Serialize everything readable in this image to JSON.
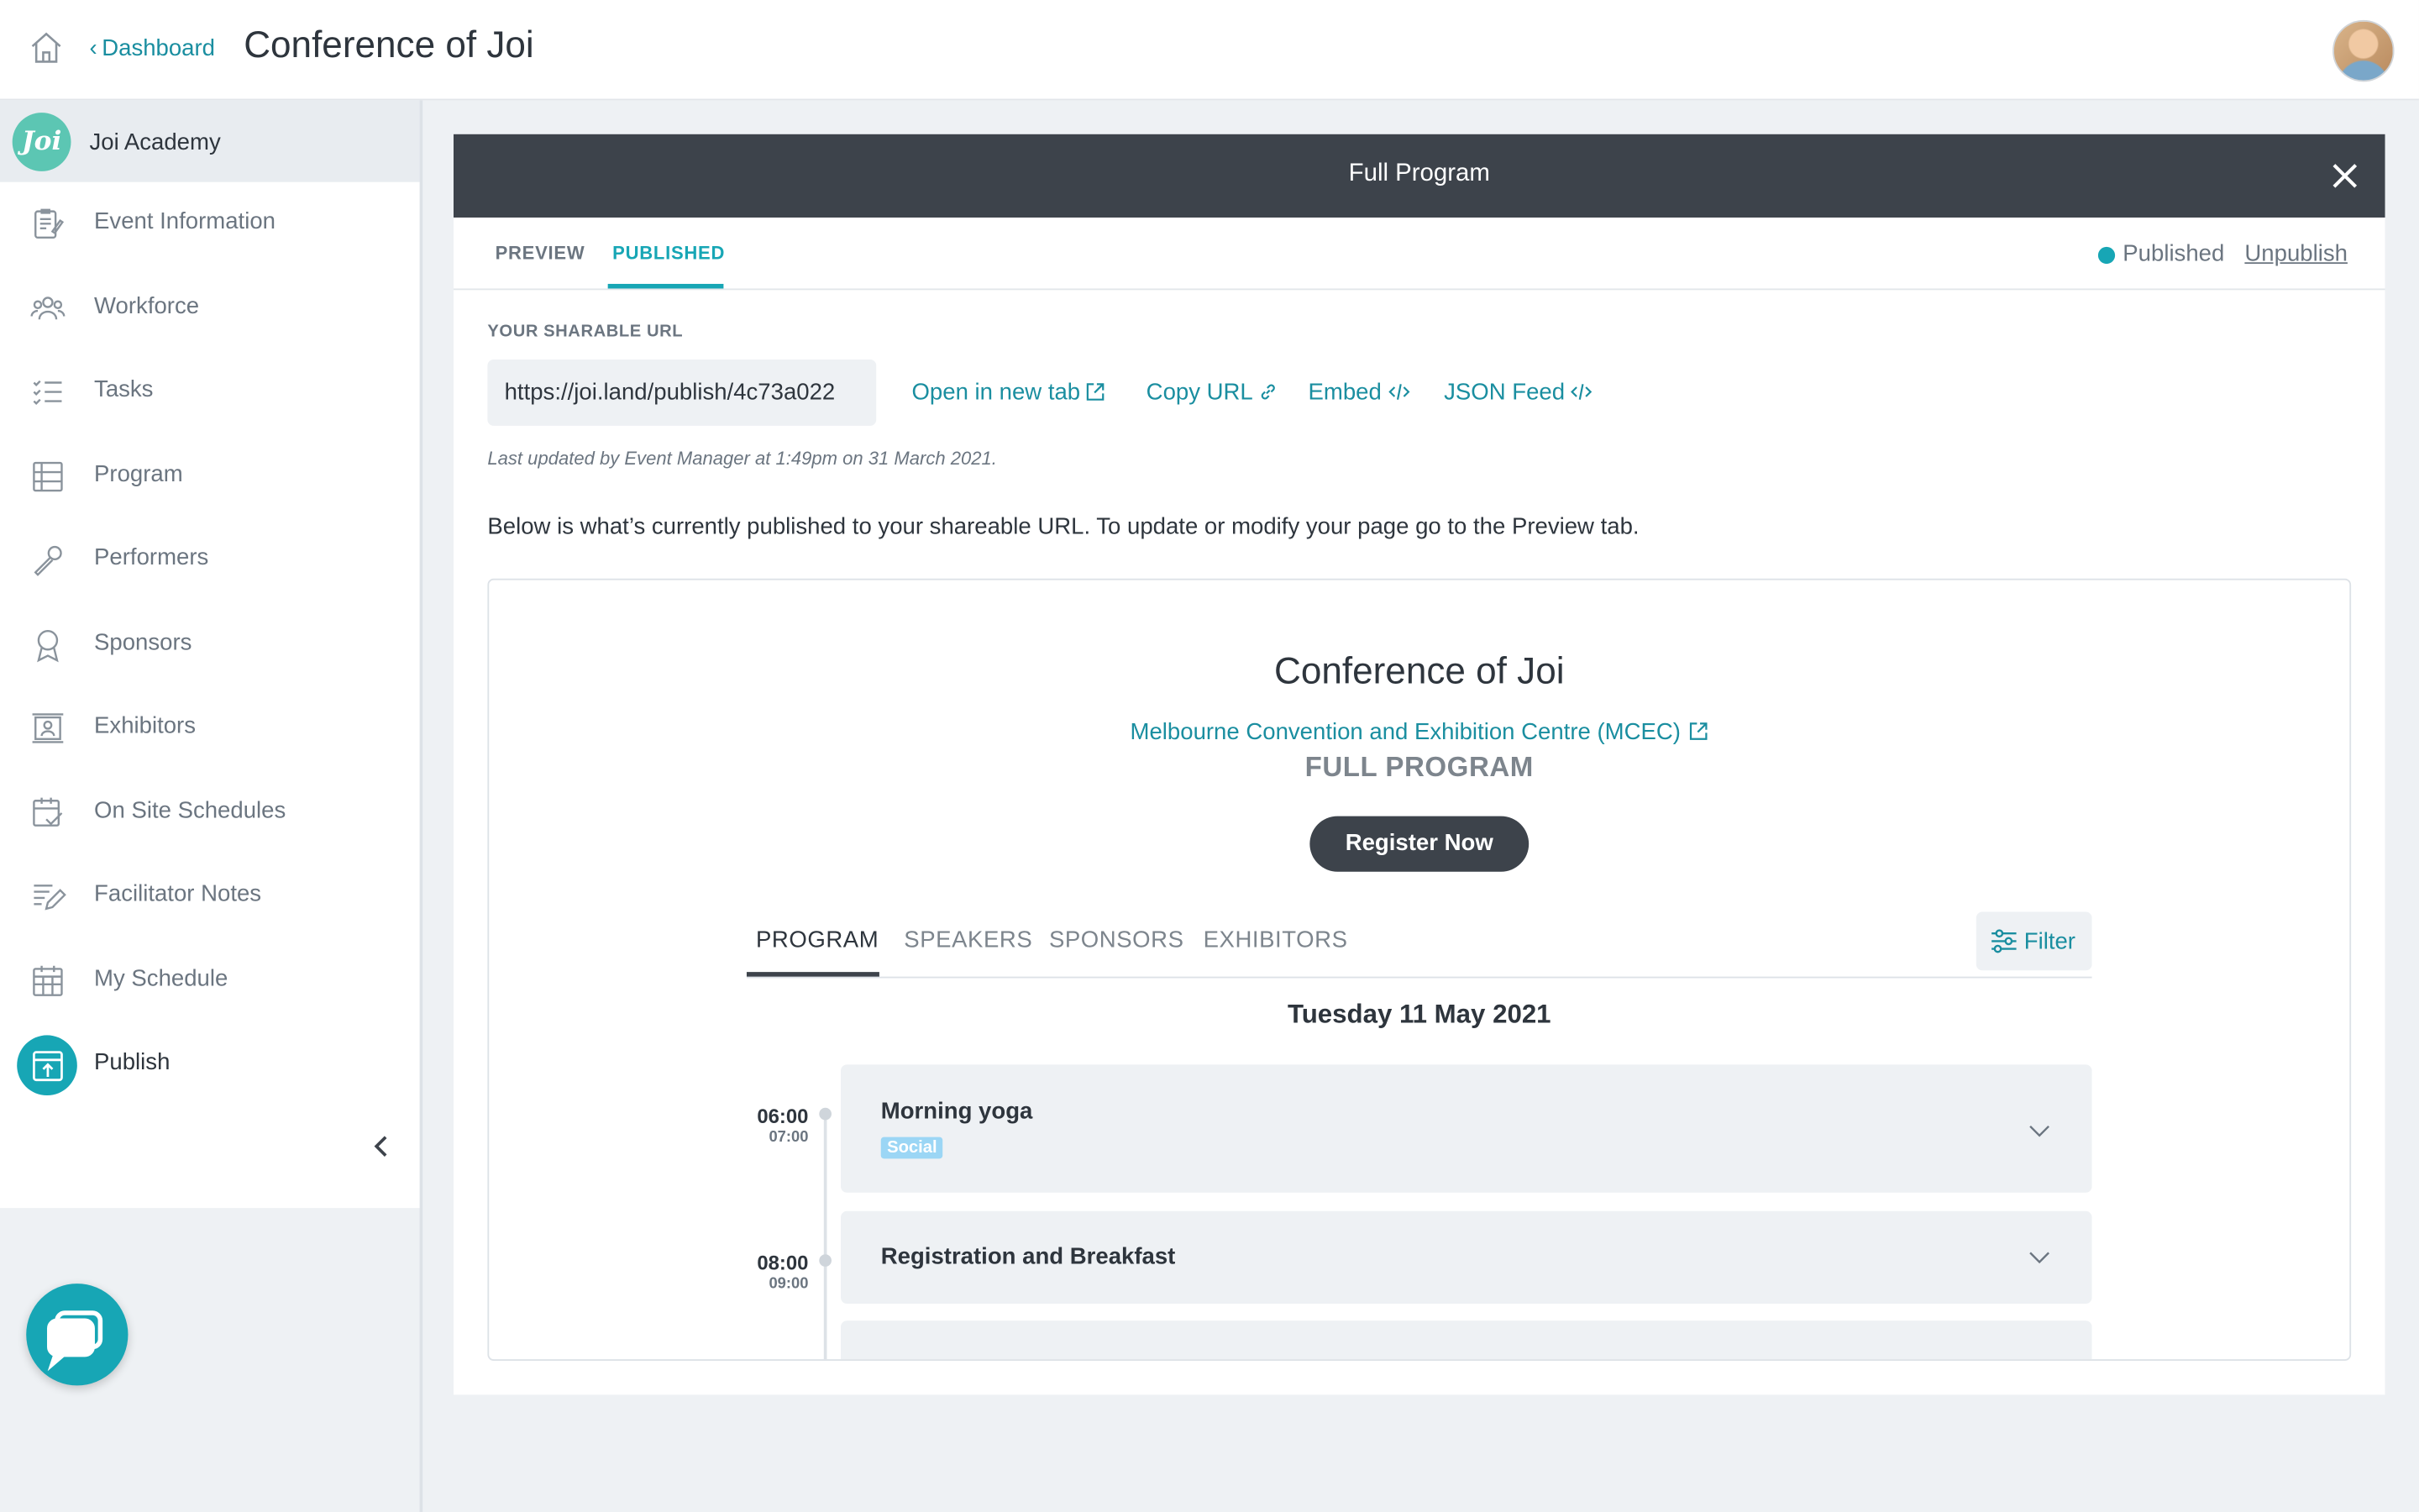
{
  "header": {
    "breadcrumb": "Dashboard",
    "title": "Conference of Joi"
  },
  "sidebar": {
    "org_logo": "Joi",
    "org_name": "Joi Academy",
    "items": [
      {
        "label": "Event Information",
        "icon": "edit-document-icon"
      },
      {
        "label": "Workforce",
        "icon": "people-icon"
      },
      {
        "label": "Tasks",
        "icon": "checklist-icon"
      },
      {
        "label": "Program",
        "icon": "program-list-icon"
      },
      {
        "label": "Performers",
        "icon": "microphone-icon"
      },
      {
        "label": "Sponsors",
        "icon": "award-ribbon-icon"
      },
      {
        "label": "Exhibitors",
        "icon": "exhibitor-booth-icon"
      },
      {
        "label": "On Site Schedules",
        "icon": "calendar-check-icon"
      },
      {
        "label": "Facilitator Notes",
        "icon": "notes-pen-icon"
      },
      {
        "label": "My Schedule",
        "icon": "calendar-grid-icon"
      },
      {
        "label": "Publish",
        "icon": "publish-icon",
        "active": true
      }
    ]
  },
  "panel": {
    "title": "Full Program",
    "tabs": {
      "preview": "PREVIEW",
      "published": "PUBLISHED"
    },
    "active_tab": "PUBLISHED",
    "status": "Published",
    "unpublish": "Unpublish",
    "url_label": "YOUR SHARABLE URL",
    "url": "https://joi.land/publish/4c73a022",
    "links": {
      "open": "Open in new tab",
      "copy": "Copy URL",
      "embed": "Embed",
      "json": "JSON Feed"
    },
    "updated": "Last updated by Event Manager at 1:49pm on 31 March 2021.",
    "description": "Below is what’s currently published to your shareable URL. To update or modify your page go to the Preview tab."
  },
  "preview": {
    "event_title": "Conference of Joi",
    "venue": "Melbourne Convention and Exhibition Centre (MCEC)",
    "heading": "FULL PROGRAM",
    "register": "Register Now",
    "tabs": [
      "PROGRAM",
      "SPEAKERS",
      "SPONSORS",
      "EXHIBITORS"
    ],
    "active_tab": "PROGRAM",
    "filter": "Filter",
    "date": "Tuesday 11 May 2021",
    "sessions": [
      {
        "start": "06:00",
        "end": "07:00",
        "title": "Morning yoga",
        "tag": "Social"
      },
      {
        "start": "08:00",
        "end": "09:00",
        "title": "Registration and Breakfast"
      }
    ]
  },
  "colors": {
    "accent": "#17a6b5",
    "link": "#1a8ea0",
    "header_dark": "#3d434b",
    "tag_social": "#9bd6f5"
  }
}
